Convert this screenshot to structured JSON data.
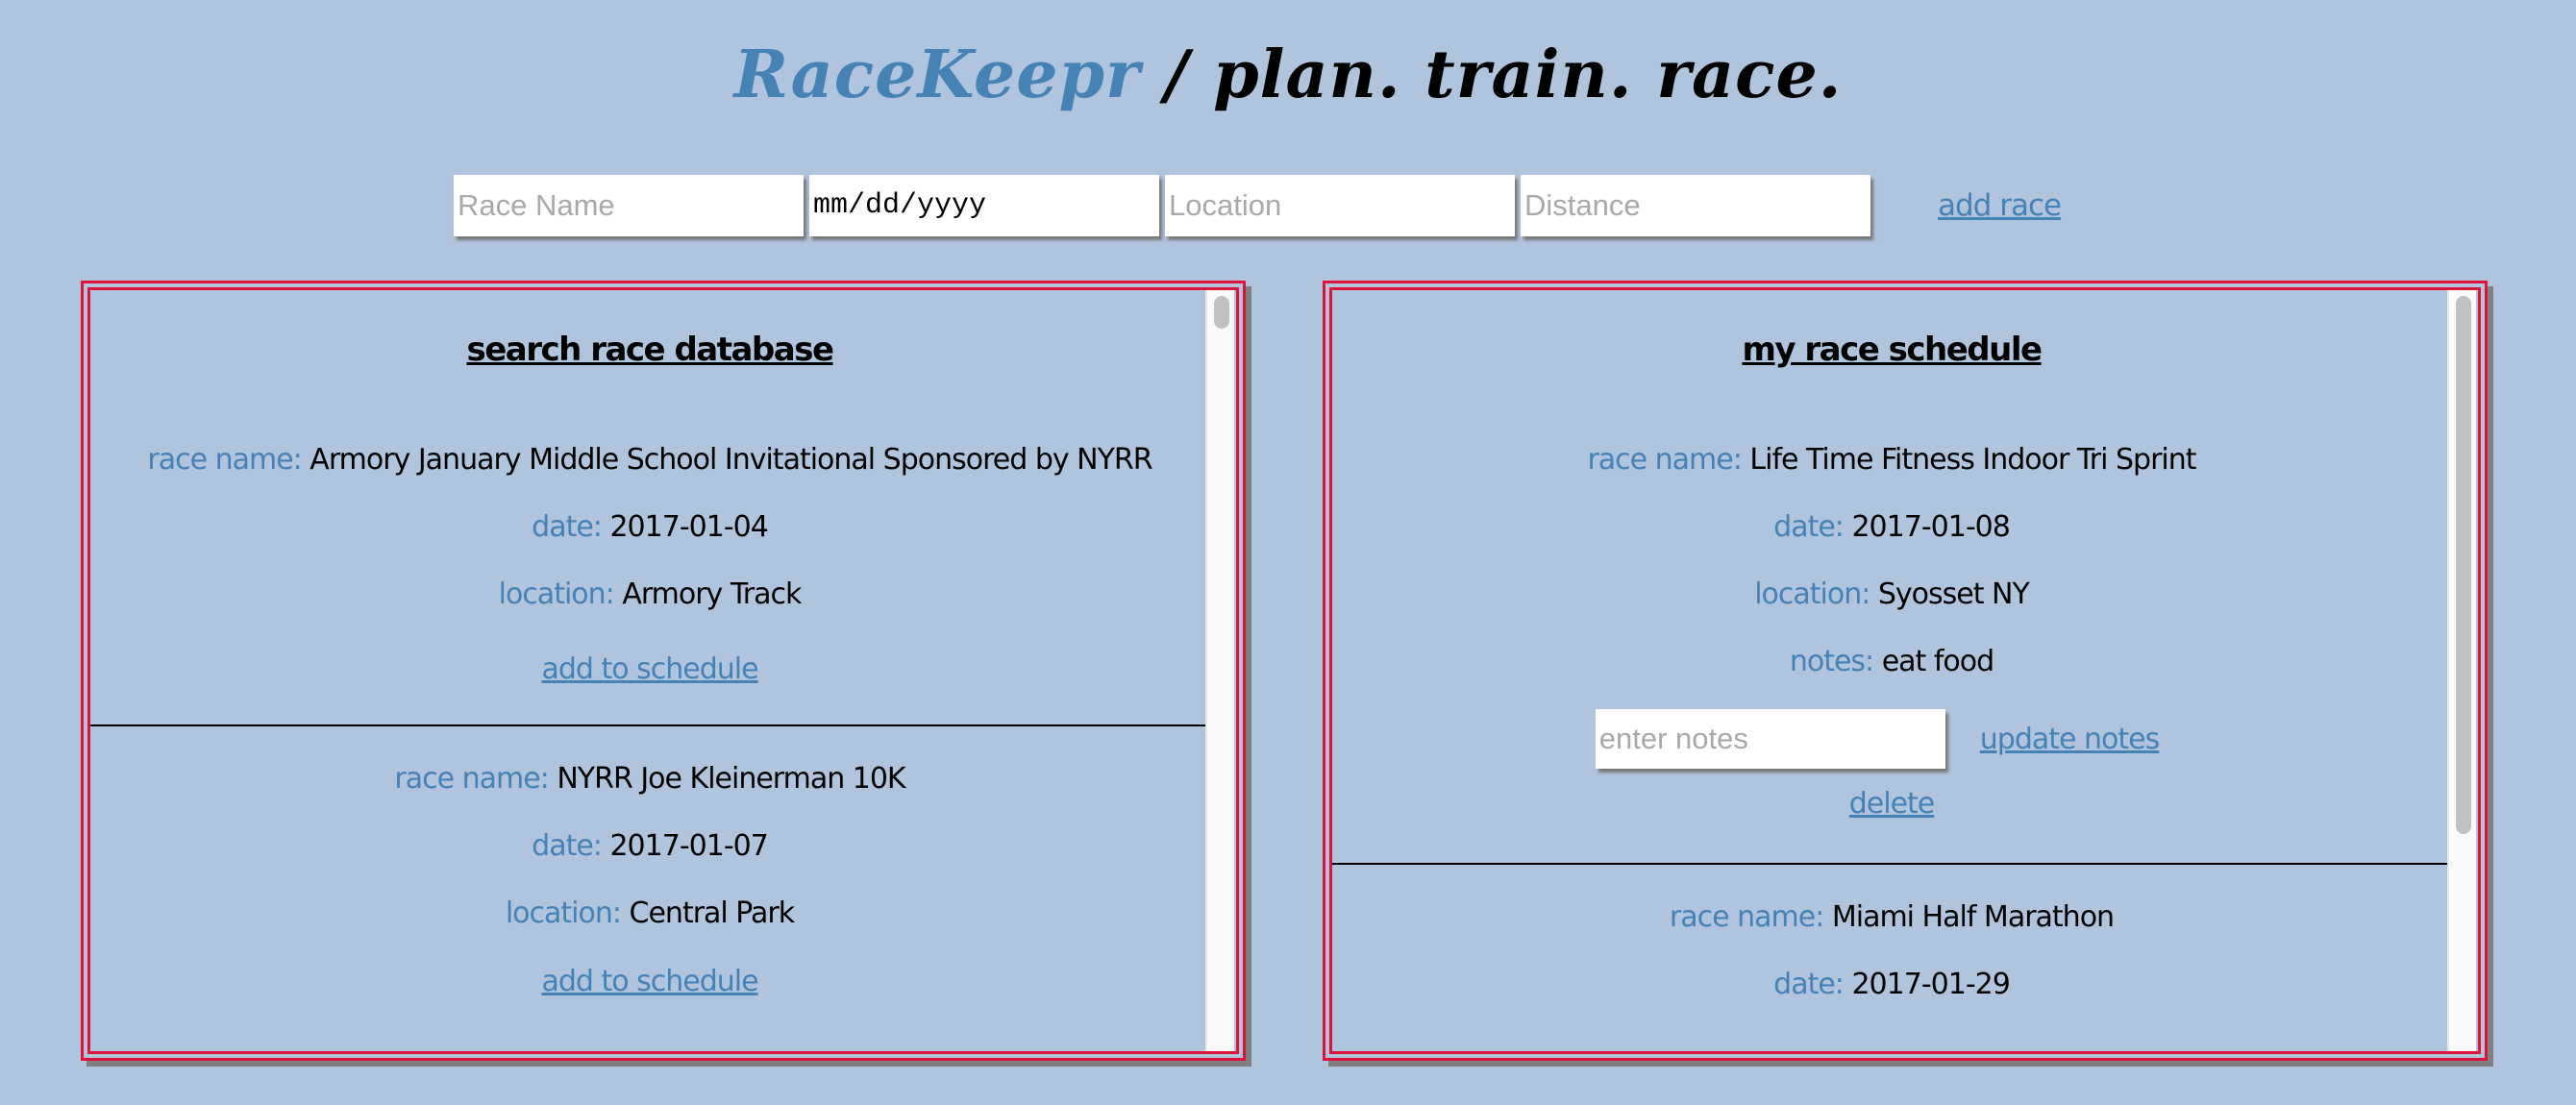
{
  "header": {
    "brand": "RaceKeepr",
    "separator": " / ",
    "tagline": "plan. train. race."
  },
  "add_form": {
    "race_name_placeholder": "Race Name",
    "date_placeholder": "mm/dd/yyyy",
    "location_placeholder": "Location",
    "distance_placeholder": "Distance",
    "race_name_value": "",
    "date_value": "",
    "location_value": "",
    "distance_value": "",
    "add_label": "add race"
  },
  "labels": {
    "race_name": "race name:",
    "date": "date:",
    "location": "location:",
    "notes": "notes:"
  },
  "search_panel": {
    "heading": "search race database",
    "add_to_schedule_label": "add to schedule",
    "races": [
      {
        "name": "Armory January Middle School Invitational Sponsored by NYRR",
        "date": "2017-01-04",
        "location": "Armory Track"
      },
      {
        "name": "NYRR Joe Kleinerman 10K",
        "date": "2017-01-07",
        "location": "Central Park"
      }
    ]
  },
  "schedule_panel": {
    "heading": "my race schedule",
    "notes_placeholder": "enter notes",
    "notes_value": "",
    "update_notes_label": "update notes",
    "delete_label": "delete",
    "races": [
      {
        "name": "Life Time Fitness Indoor Tri Sprint",
        "date": "2017-01-08",
        "location": "Syosset NY",
        "notes": "eat food"
      },
      {
        "name": "Miami Half Marathon",
        "date": "2017-01-29"
      }
    ]
  },
  "colors": {
    "background": "#B0C4DE",
    "accent": "#4682B4",
    "panel_border": "#DC143C"
  }
}
